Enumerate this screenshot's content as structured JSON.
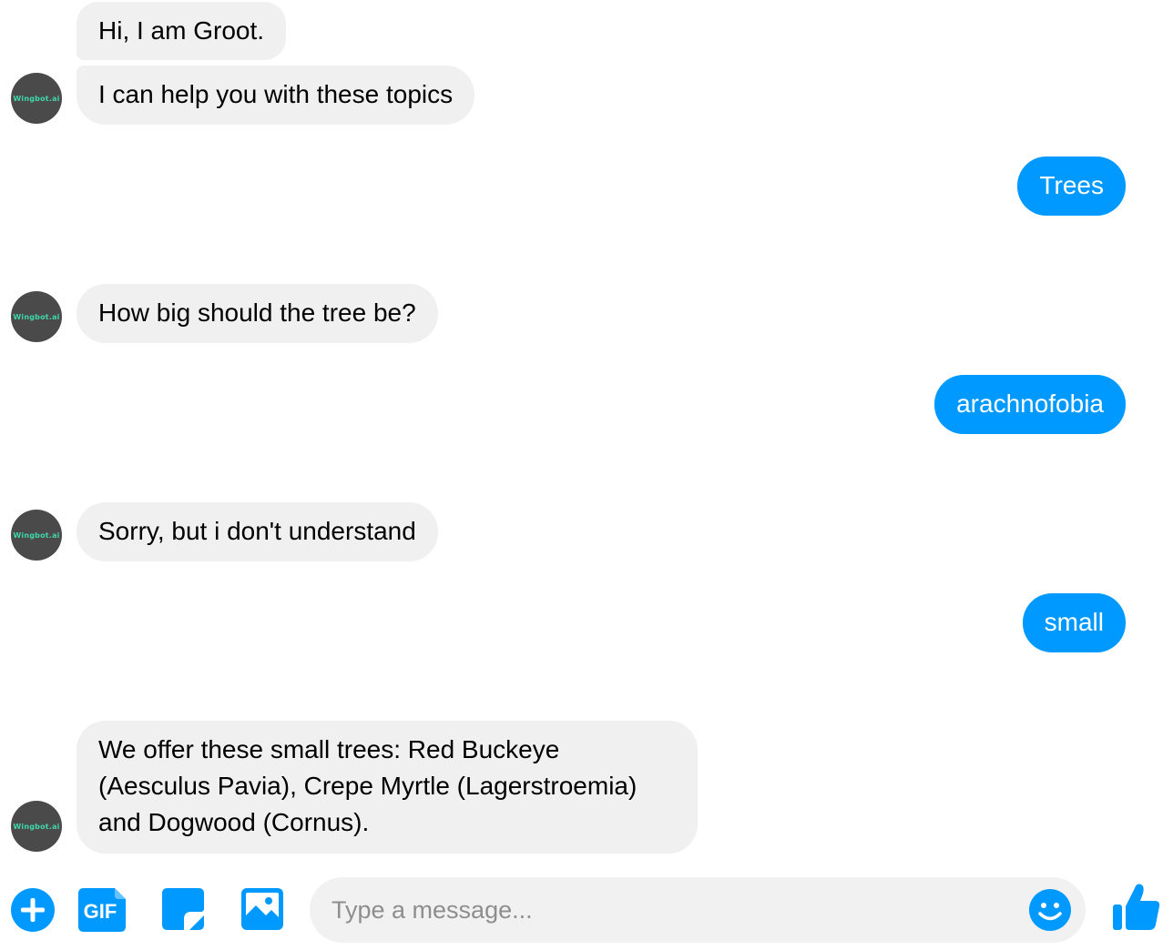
{
  "bot": {
    "avatar_text": "Wingbot.ai"
  },
  "messages": [
    {
      "from": "bot",
      "text": "Hi, I am Groot."
    },
    {
      "from": "bot",
      "text": "I can help you with these topics"
    },
    {
      "from": "user",
      "text": "Trees"
    },
    {
      "from": "bot",
      "text": "How big should the tree be?"
    },
    {
      "from": "user",
      "text": "arachnofobia"
    },
    {
      "from": "bot",
      "text": "Sorry, but i don't understand"
    },
    {
      "from": "user",
      "text": "small"
    },
    {
      "from": "bot",
      "text": "We offer these small trees: Red Buckeye (Aesculus Pavia), Crepe Myrtle (Lagerstroemia) and Dogwood (Cornus)."
    }
  ],
  "composer": {
    "placeholder": "Type a message...",
    "gif_label": "GIF",
    "icons": [
      "plus-icon",
      "gif-icon",
      "sticker-icon",
      "image-icon",
      "emoji-icon",
      "like-icon"
    ]
  },
  "colors": {
    "accent": "#0099ff",
    "bot_bubble": "#f0f0f0",
    "input_bg": "#f1f1f1",
    "avatar_bg": "#4a4a4a"
  }
}
